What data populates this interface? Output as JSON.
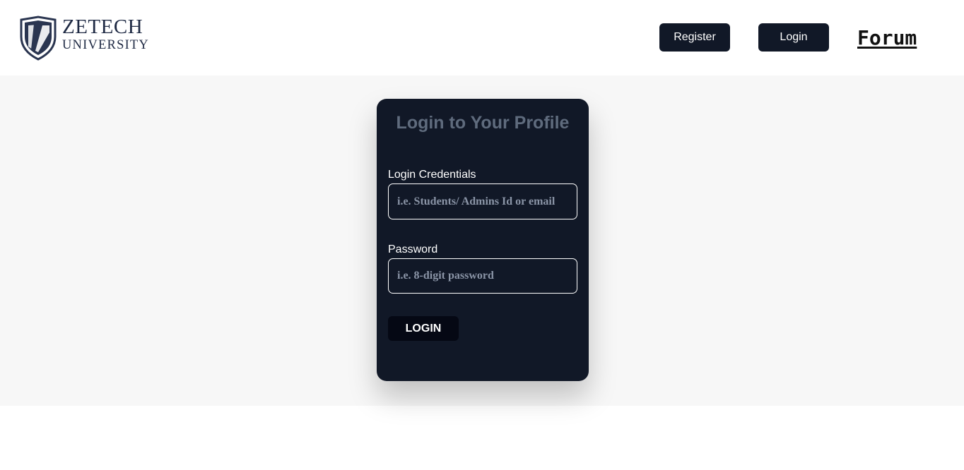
{
  "header": {
    "logo": {
      "line1": "ZETECH",
      "line2": "UNIVERSITY",
      "icon": "shield-icon"
    },
    "nav": {
      "register_label": "Register",
      "login_label": "Login",
      "forum_label": "Forum"
    }
  },
  "login_card": {
    "title": "Login to Your Profile",
    "credentials": {
      "label": "Login Credentials",
      "placeholder": "i.e. Students/ Admins Id or email",
      "value": ""
    },
    "password": {
      "label": "Password",
      "placeholder": "i.e. 8-digit password",
      "value": ""
    },
    "submit_label": "LOGIN"
  },
  "colors": {
    "nav_button_bg": "#111827",
    "card_bg": "#111827",
    "card_title": "#5f6b7d",
    "submit_bg": "#050814",
    "page_band_bg": "#f7f7f7",
    "logo_navy": "#1f2a44"
  }
}
